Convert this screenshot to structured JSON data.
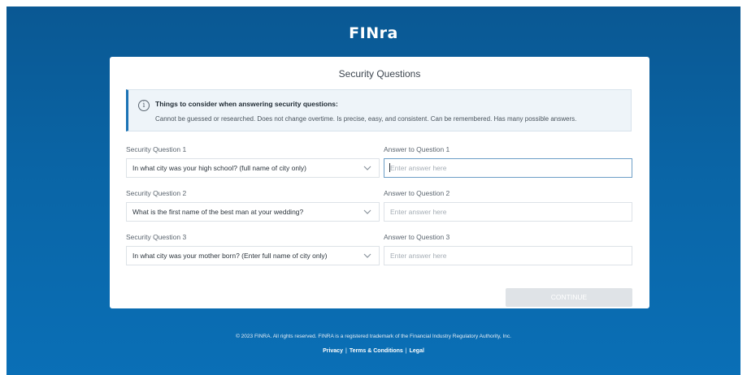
{
  "brand": {
    "logo_text": "FINra"
  },
  "card": {
    "title": "Security Questions",
    "info": {
      "icon": "info-icon",
      "title": "Things to consider when answering security questions:",
      "body": "Cannot be guessed or researched. Does not change overtime. Is precise, easy, and consistent. Can be remembered. Has many possible answers."
    },
    "questions": [
      {
        "label": "Security Question 1",
        "selected": "In what city was your high school? (full name of city only)",
        "answer_label": "Answer to Question 1",
        "answer_placeholder": "Enter answer here",
        "answer_value": ""
      },
      {
        "label": "Security Question 2",
        "selected": "What is the first name of the best man at your wedding?",
        "answer_label": "Answer to Question 2",
        "answer_placeholder": "Enter answer here",
        "answer_value": ""
      },
      {
        "label": "Security Question 3",
        "selected": "In what city was your mother born? (Enter full name of city only)",
        "answer_label": "Answer to Question 3",
        "answer_placeholder": "Enter answer here",
        "answer_value": ""
      }
    ],
    "continue_label": "CONTINUE"
  },
  "footer": {
    "copyright": "© 2023 FINRA. All rights reserved. FINRA is a registered trademark of the Financial Industry Regulatory Authority, Inc.",
    "links": [
      "Privacy",
      "Terms & Conditions",
      "Legal"
    ],
    "separator": "|"
  },
  "colors": {
    "background_top": "#0a5893",
    "background_bottom": "#0a6fb6",
    "info_accent": "#1b73b5",
    "button_disabled": "#dfe3e7"
  }
}
